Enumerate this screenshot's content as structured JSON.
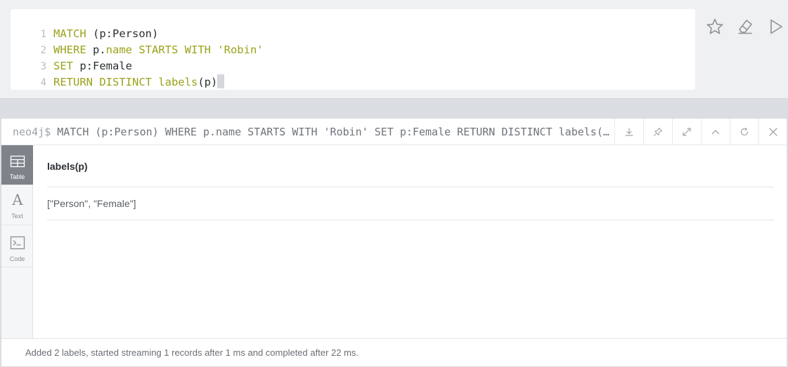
{
  "editor": {
    "lines": [
      {
        "num": "1",
        "segments": [
          {
            "text": "MATCH",
            "cls": "kw"
          },
          {
            "text": " (p:Person)",
            "cls": "tx"
          }
        ]
      },
      {
        "num": "2",
        "segments": [
          {
            "text": "WHERE",
            "cls": "kw"
          },
          {
            "text": " p.",
            "cls": "tx"
          },
          {
            "text": "name STARTS WITH 'Robin'",
            "cls": "kw"
          }
        ]
      },
      {
        "num": "3",
        "segments": [
          {
            "text": "SET",
            "cls": "kw"
          },
          {
            "text": " p:Female",
            "cls": "tx"
          }
        ]
      },
      {
        "num": "4",
        "segments": [
          {
            "text": "RETURN DISTINCT labels",
            "cls": "kw"
          },
          {
            "text": "(p)",
            "cls": "tx"
          }
        ]
      }
    ],
    "actions": {
      "favorite_icon": "star-icon",
      "clear_icon": "eraser-icon",
      "run_icon": "play-icon"
    }
  },
  "frame": {
    "prompt": "neo4j$",
    "query": "MATCH (p:Person) WHERE p.name STARTS WITH 'Robin' SET p:Female RETURN DISTINCT labels(p)",
    "header_icons": [
      "download-icon",
      "pin-icon",
      "fullscreen-icon",
      "collapse-icon",
      "rerun-icon",
      "close-icon"
    ],
    "views": [
      {
        "label": "Table",
        "icon": "table-icon",
        "active": true
      },
      {
        "label": "Text",
        "icon": "text-icon",
        "active": false
      },
      {
        "label": "Code",
        "icon": "code-icon",
        "active": false
      }
    ],
    "table": {
      "columns": [
        "labels(p)"
      ],
      "rows": [
        [
          "[\"Person\", \"Female\"]"
        ]
      ]
    },
    "status": "Added 2 labels, started streaming 1 records after 1 ms and completed after 22 ms."
  },
  "colors": {
    "keyword": "#9aa21a",
    "text": "#2b2f33",
    "active_tab": "#7e8389"
  }
}
